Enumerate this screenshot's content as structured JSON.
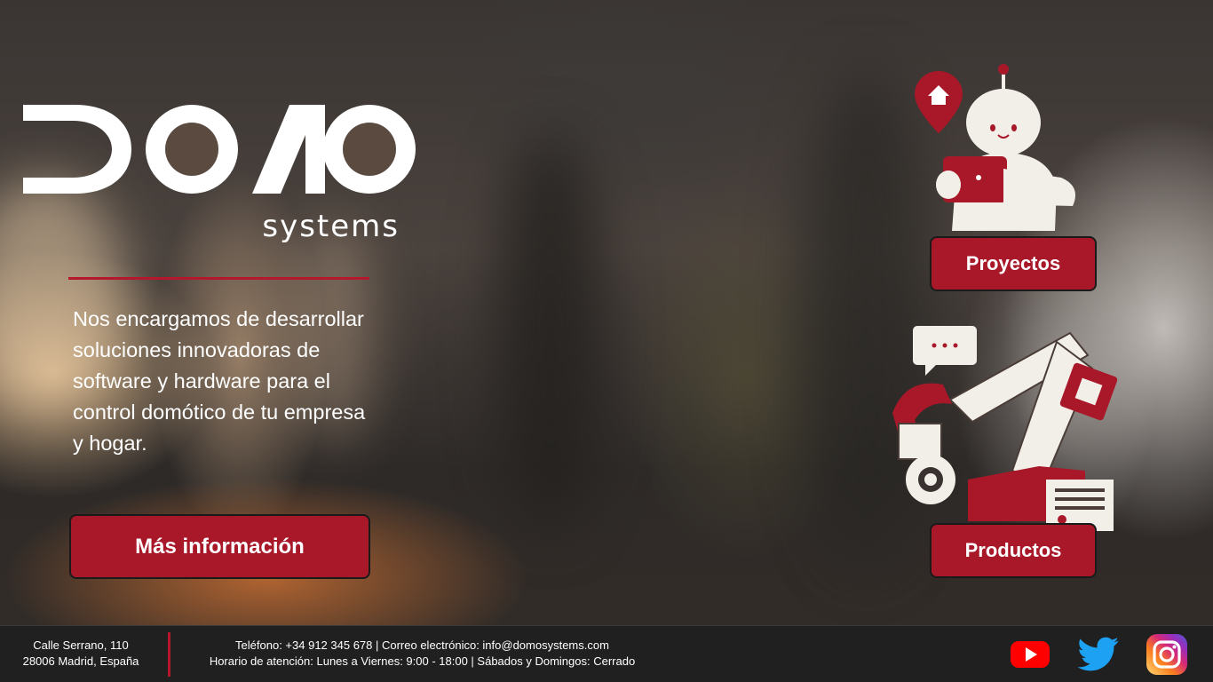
{
  "brand": {
    "name": "DOMO",
    "sub": "systems"
  },
  "hero": {
    "tagline": "Nos encargamos de desarrollar soluciones innovadoras de software y hardware para el control domótico de tu empresa y hogar.",
    "cta_label": "Más información"
  },
  "cards": {
    "projects_label": "Proyectos",
    "products_label": "Productos"
  },
  "footer": {
    "address_line1": "Calle Serrano, 110",
    "address_line2": "28006 Madrid, España",
    "contact_line1": "Teléfono: +34 912 345 678 | Correo electrónico: info@domosystems.com",
    "contact_line2": "Horario de atención: Lunes a Viernes: 9:00 - 18:00 | Sábados y Domingos: Cerrado"
  },
  "social": [
    "youtube-icon",
    "twitter-icon",
    "instagram-icon"
  ],
  "colors": {
    "accent": "#a81829",
    "footer_bg": "#202020",
    "divider": "#b5182c"
  }
}
